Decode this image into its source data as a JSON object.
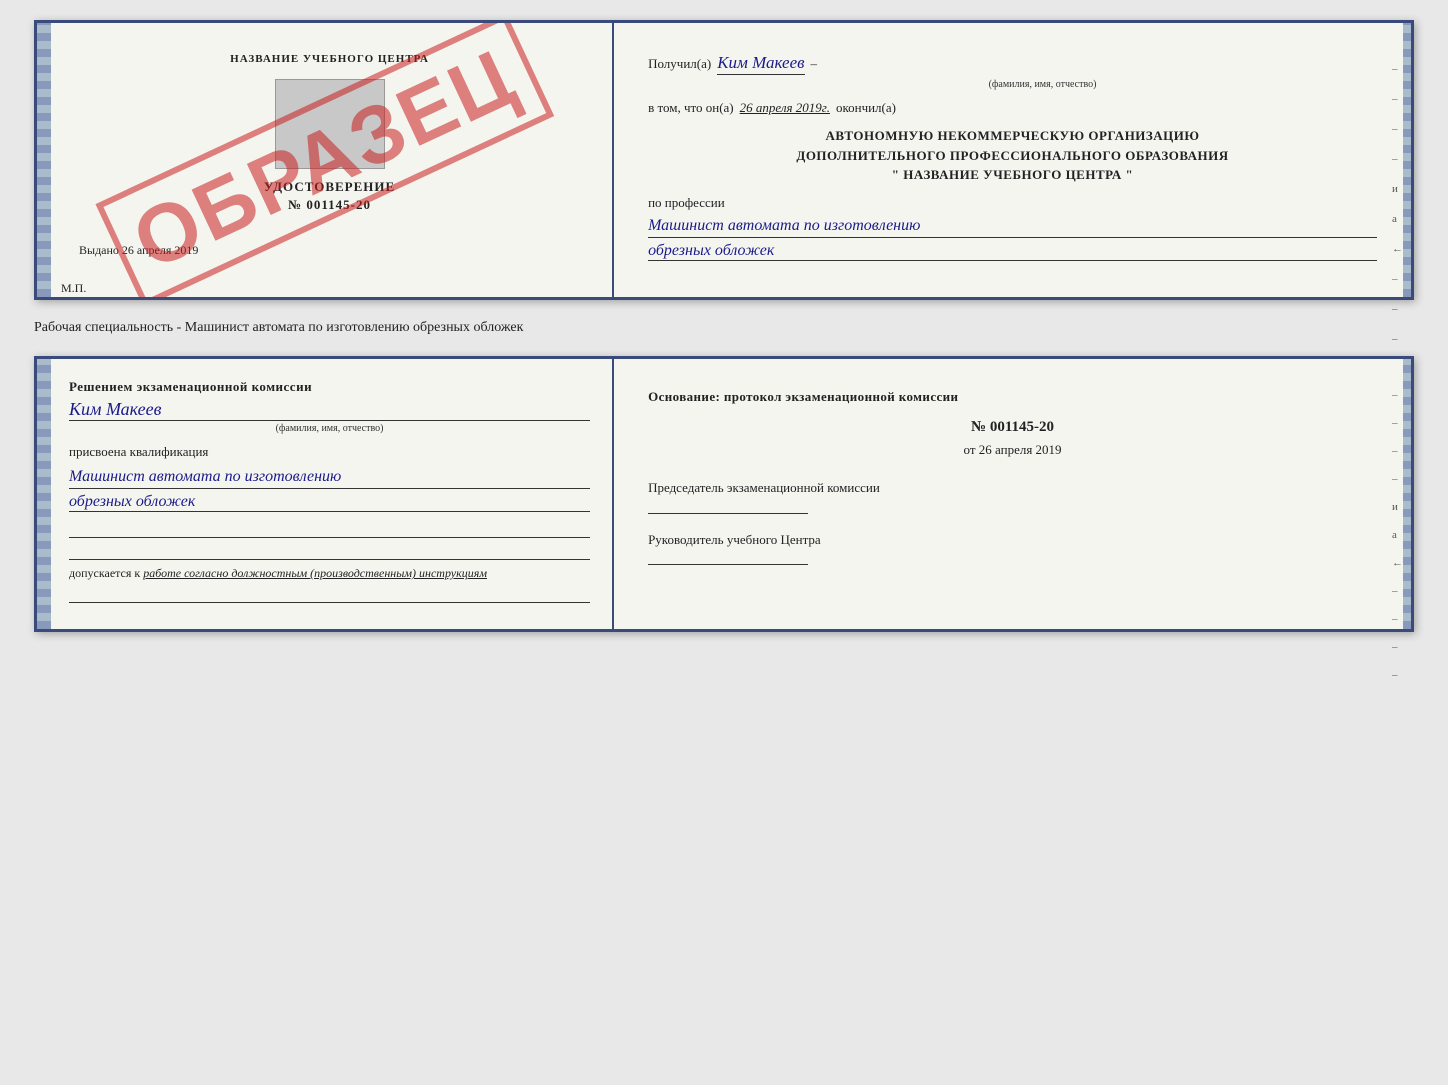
{
  "doc1": {
    "left": {
      "school_name": "НАЗВАНИЕ УЧЕБНОГО ЦЕНТРА",
      "cert_title": "УДОСТОВЕРЕНИЕ",
      "cert_number": "№ 001145-20",
      "issued_label": "Выдано",
      "issued_date": "26 апреля 2019",
      "mp": "М.П.",
      "watermark": "ОБРАЗЕЦ"
    },
    "right": {
      "received_prefix": "Получил(а)",
      "received_name": "Ким Макеев",
      "received_dash": "–",
      "fio_sub": "(фамилия, имя, отчество)",
      "vtom_prefix": "в том, что он(а)",
      "vtom_date": "26 апреля 2019г.",
      "finished": "окончил(а)",
      "org_line1": "АВТОНОМНУЮ НЕКОММЕРЧЕСКУЮ ОРГАНИЗАЦИЮ",
      "org_line2": "ДОПОЛНИТЕЛЬНОГО ПРОФЕССИОНАЛЬНОГО ОБРАЗОВАНИЯ",
      "org_line3": "\"   НАЗВАНИЕ УЧЕБНОГО ЦЕНТРА   \"",
      "profession_label": "по профессии",
      "profession_line1": "Машинист автомата по изготовлению",
      "profession_line2": "обрезных обложек",
      "dashes": [
        "–",
        "–",
        "–",
        "–",
        "и",
        "а",
        "←",
        "–",
        "–",
        "–",
        "–"
      ]
    }
  },
  "caption": "Рабочая специальность - Машинист автомата по изготовлению обрезных обложек",
  "doc2": {
    "left": {
      "decision_text": "Решением экзаменационной комиссии",
      "name": "Ким Макеев",
      "fio_sub": "(фамилия, имя, отчество)",
      "assigned_label": "присвоена квалификация",
      "qual_line1": "Машинист автомата по изготовлению",
      "qual_line2": "обрезных обложек",
      "admission_prefix": "допускается к",
      "admission_italic": "работе согласно должностным (производственным) инструкциям"
    },
    "right": {
      "basis_text": "Основание: протокол экзаменационной комиссии",
      "protocol_num": "№  001145-20",
      "protocol_date_prefix": "от",
      "protocol_date": "26 апреля 2019",
      "chairman_label": "Председатель экзаменационной комиссии",
      "head_label": "Руководитель учебного Центра",
      "dashes": [
        "–",
        "–",
        "–",
        "–",
        "и",
        "а",
        "←",
        "–",
        "–",
        "–",
        "–"
      ]
    }
  }
}
